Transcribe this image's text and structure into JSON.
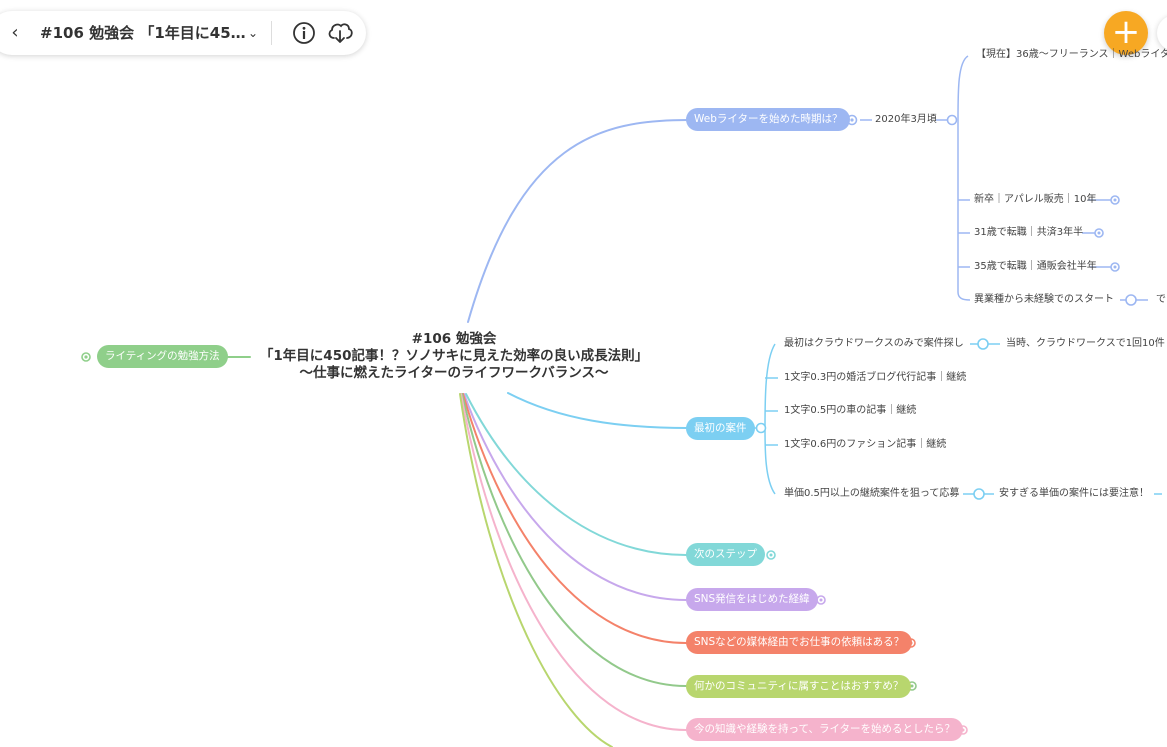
{
  "header": {
    "back_icon": "chevron-left-icon",
    "title": "#106 勉強会 「1年目に45…",
    "dropdown_icon": "chevron-down-icon",
    "info_icon": "info-icon",
    "download_icon": "cloud-download-icon"
  },
  "fab": {
    "label": "+",
    "color": "#f7a823"
  },
  "root": {
    "line1": "#106 勉強会",
    "line2": "「1年目に450記事！？ソノサキに見えた効率の良い成長法則」",
    "line3": "〜仕事に燃えたライターのライフワークバランス〜"
  },
  "left_branch": {
    "label": "ライティングの勉強方法",
    "color": "#8fcf8a"
  },
  "branches": {
    "web_start": {
      "label": "Webライターを始めた時期は？",
      "color": "#9db7f2"
    },
    "first_job": {
      "label": "最初の案件",
      "color": "#7ccff2"
    },
    "next_step": {
      "label": "次のステップ",
      "color": "#82d8d8"
    },
    "sns_start": {
      "label": "SNS発信をはじめた経緯",
      "color": "#c7a8ec"
    },
    "sns_requests": {
      "label": "SNSなどの媒体経由でお仕事の依頼はある？",
      "color": "#f4826a"
    },
    "community": {
      "label": "何かのコミュニティに属すことはおすすめ？",
      "color": "#b8d66e"
    },
    "start_now": {
      "label": "今の知識や経験を持って、ライターを始めるとしたら？",
      "color": "#f5b3cc"
    }
  },
  "web_start_children": {
    "date": "2020年3月頃",
    "current": "【現在】36歳〜フリーランス｜Webライタ",
    "new_grad": "新卒｜アパレル販売｜10年",
    "age31": "31歳で転職｜共済3年半",
    "age35": "35歳で転職｜通販会社半年",
    "no_exp": "異業種から未経験でのスタート",
    "no_exp_child": "で"
  },
  "first_job_children": {
    "crowdworks": "最初はクラウドワークスのみで案件探し",
    "crowdworks_child": "当時、クラウドワークスで1回10件",
    "job1": "1文字0.3円の婚活ブログ代行記事｜継続",
    "job2": "1文字0.5円の車の記事｜継続",
    "job3": "1文字0.6円のファション記事｜継続",
    "apply": "単価0.5円以上の継続案件を狙って応募",
    "apply_child": "安すぎる単価の案件には要注意！"
  }
}
